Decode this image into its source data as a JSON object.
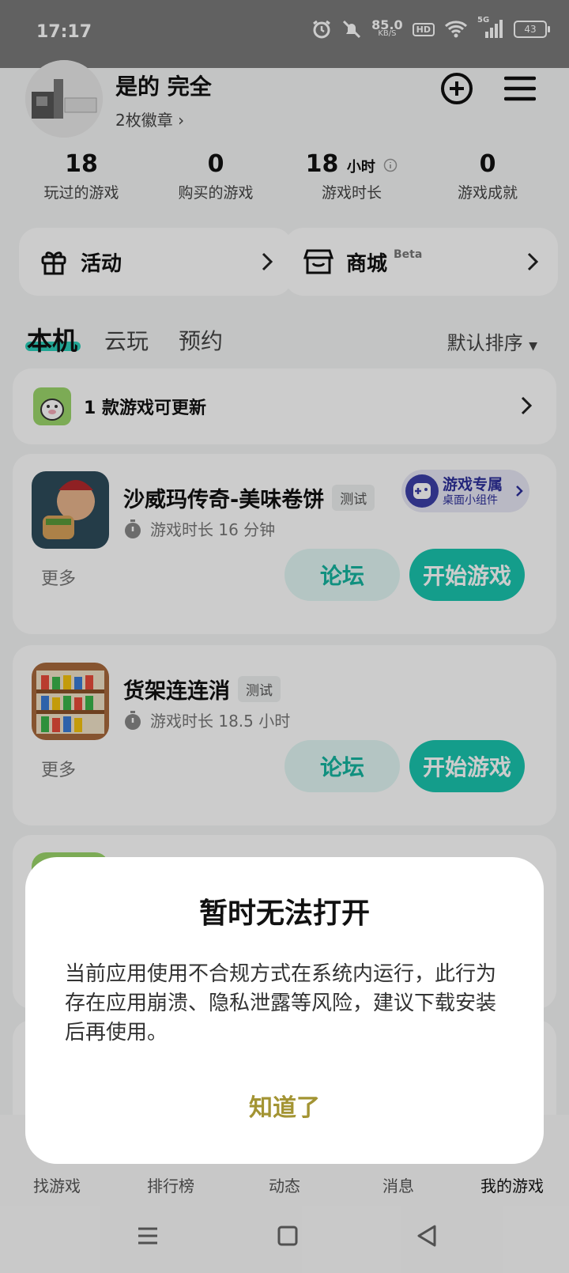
{
  "status_bar": {
    "time": "17:17",
    "net_speed": "85.0",
    "net_unit": "KB/S",
    "hd": "HD",
    "signal_label": "5G",
    "battery": "43"
  },
  "profile": {
    "username": "是的 完全",
    "badges": "2枚徽章 ›"
  },
  "stats": [
    {
      "value": "18",
      "unit": "",
      "label": "玩过的游戏"
    },
    {
      "value": "0",
      "unit": "",
      "label": "购买的游戏"
    },
    {
      "value": "18",
      "unit": "小时",
      "label": "游戏时长"
    },
    {
      "value": "0",
      "unit": "",
      "label": "游戏成就"
    }
  ],
  "quick_links": {
    "activity": "活动",
    "mall": "商城",
    "mall_tag": "Beta"
  },
  "tabs": {
    "local": "本机",
    "cloud": "云玩",
    "reserve": "预约",
    "sort": "默认排序"
  },
  "update_banner": {
    "text": "1 款游戏可更新"
  },
  "games": [
    {
      "title": "沙威玛传奇-美味卷饼",
      "tag": "测试",
      "playtime": "游戏时长 16 分钟",
      "widget_title": "游戏专属",
      "widget_sub": "桌面小组件",
      "more": "更多",
      "forum": "论坛",
      "start": "开始游戏"
    },
    {
      "title": "货架连连消",
      "tag": "测试",
      "playtime": "游戏时长 18.5 小时",
      "more": "更多",
      "forum": "论坛",
      "start": "开始游戏"
    }
  ],
  "bottom_nav": [
    "找游戏",
    "排行榜",
    "动态",
    "消息",
    "我的游戏"
  ],
  "dialog": {
    "title": "暂时无法打开",
    "message": "当前应用使用不合规方式在系统内运行，此行为存在应用崩溃、隐私泄露等风险，建议下载安装后再使用。",
    "ok": "知道了"
  },
  "colors": {
    "accent": "#19c5ae",
    "dialog_button": "#a39433"
  }
}
